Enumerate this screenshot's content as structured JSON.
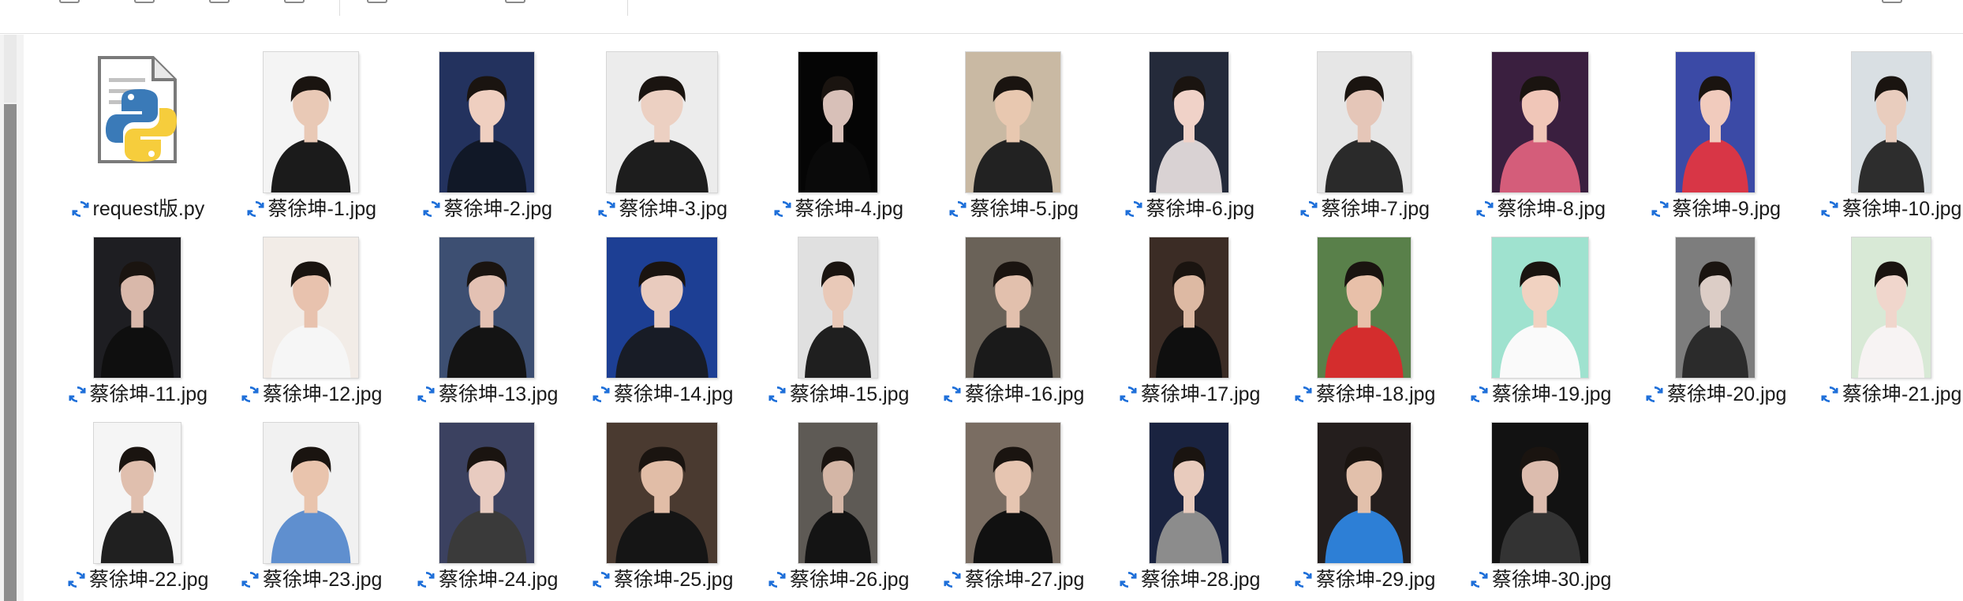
{
  "toolbar": {
    "view_label": ""
  },
  "files": [
    {
      "name": "request版.py",
      "type": "python"
    },
    {
      "name": "蔡徐坤-1.jpg",
      "bg": "#f4f4f4",
      "coat": "#1b1b1b",
      "skin": "#e9c9b6"
    },
    {
      "name": "蔡徐坤-2.jpg",
      "bg": "#23325e",
      "coat": "#111827",
      "skin": "#efcfc0"
    },
    {
      "name": "蔡徐坤-3.jpg",
      "bg": "#ececec",
      "coat": "#1d1d1d",
      "skin": "#ecd0c2"
    },
    {
      "name": "蔡徐坤-4.jpg",
      "bg": "#050505",
      "coat": "#0a0a0a",
      "skin": "#d8c0b8"
    },
    {
      "name": "蔡徐坤-5.jpg",
      "bg": "#c9b9a3",
      "coat": "#222222",
      "skin": "#e8c8b0"
    },
    {
      "name": "蔡徐坤-6.jpg",
      "bg": "#242a3a",
      "coat": "#d9d2d3",
      "skin": "#f0d2c8"
    },
    {
      "name": "蔡徐坤-7.jpg",
      "bg": "#e6e6e6",
      "coat": "#2a2a2a",
      "skin": "#e5c6b8"
    },
    {
      "name": "蔡徐坤-8.jpg",
      "bg": "#3a1f3f",
      "coat": "#d45d7a",
      "skin": "#f0c6b8"
    },
    {
      "name": "蔡徐坤-9.jpg",
      "bg": "#3b4aa6",
      "coat": "#d83646",
      "skin": "#f1cbbd"
    },
    {
      "name": "蔡徐坤-10.jpg",
      "bg": "#d9dfe3",
      "coat": "#2d2d2d",
      "skin": "#e9cdbe"
    },
    {
      "name": "蔡徐坤-11.jpg",
      "bg": "#1e1e22",
      "coat": "#0f0f0f",
      "skin": "#d9b8aa"
    },
    {
      "name": "蔡徐坤-12.jpg",
      "bg": "#f2ece7",
      "coat": "#f6f6f6",
      "skin": "#e8c2ae"
    },
    {
      "name": "蔡徐坤-13.jpg",
      "bg": "#3d4f72",
      "coat": "#141414",
      "skin": "#e3c1b3"
    },
    {
      "name": "蔡徐坤-14.jpg",
      "bg": "#1d3f94",
      "coat": "#181c26",
      "skin": "#e9cbbe"
    },
    {
      "name": "蔡徐坤-15.jpg",
      "bg": "#e0e0e0",
      "coat": "#1f1f1f",
      "skin": "#e9c9b8"
    },
    {
      "name": "蔡徐坤-16.jpg",
      "bg": "#6a6258",
      "coat": "#1a1a1a",
      "skin": "#e2c0ad"
    },
    {
      "name": "蔡徐坤-17.jpg",
      "bg": "#3b2c25",
      "coat": "#0f0f0f",
      "skin": "#ddb9a3"
    },
    {
      "name": "蔡徐坤-18.jpg",
      "bg": "#59804a",
      "coat": "#d42d2d",
      "skin": "#e8c0a9"
    },
    {
      "name": "蔡徐坤-19.jpg",
      "bg": "#9fe2cf",
      "coat": "#fafafa",
      "skin": "#f1d2c1"
    },
    {
      "name": "蔡徐坤-20.jpg",
      "bg": "#7d7d7d",
      "coat": "#2b2b2b",
      "skin": "#dccdc6"
    },
    {
      "name": "蔡徐坤-21.jpg",
      "bg": "#d8e9d6",
      "coat": "#f7f3f3",
      "skin": "#f0d6cc"
    },
    {
      "name": "蔡徐坤-22.jpg",
      "bg": "#f5f5f5",
      "coat": "#202020",
      "skin": "#e0bfae"
    },
    {
      "name": "蔡徐坤-23.jpg",
      "bg": "#f1f1f1",
      "coat": "#5f8fcf",
      "skin": "#e9c4ad"
    },
    {
      "name": "蔡徐坤-24.jpg",
      "bg": "#3b4160",
      "coat": "#3a3a3a",
      "skin": "#e8cbc0"
    },
    {
      "name": "蔡徐坤-25.jpg",
      "bg": "#4a3a30",
      "coat": "#151515",
      "skin": "#e1bda7"
    },
    {
      "name": "蔡徐坤-26.jpg",
      "bg": "#5e5a55",
      "coat": "#141414",
      "skin": "#d4b6a6"
    },
    {
      "name": "蔡徐坤-27.jpg",
      "bg": "#7a6d62",
      "coat": "#111111",
      "skin": "#e6c5b1"
    },
    {
      "name": "蔡徐坤-28.jpg",
      "bg": "#1a2340",
      "coat": "#8c8c8c",
      "skin": "#e8cbbd"
    },
    {
      "name": "蔡徐坤-29.jpg",
      "bg": "#241e1d",
      "coat": "#2d7fd6",
      "skin": "#e2c0ab"
    },
    {
      "name": "蔡徐坤-30.jpg",
      "bg": "#121212",
      "coat": "#333333",
      "skin": "#dcbcae"
    }
  ]
}
